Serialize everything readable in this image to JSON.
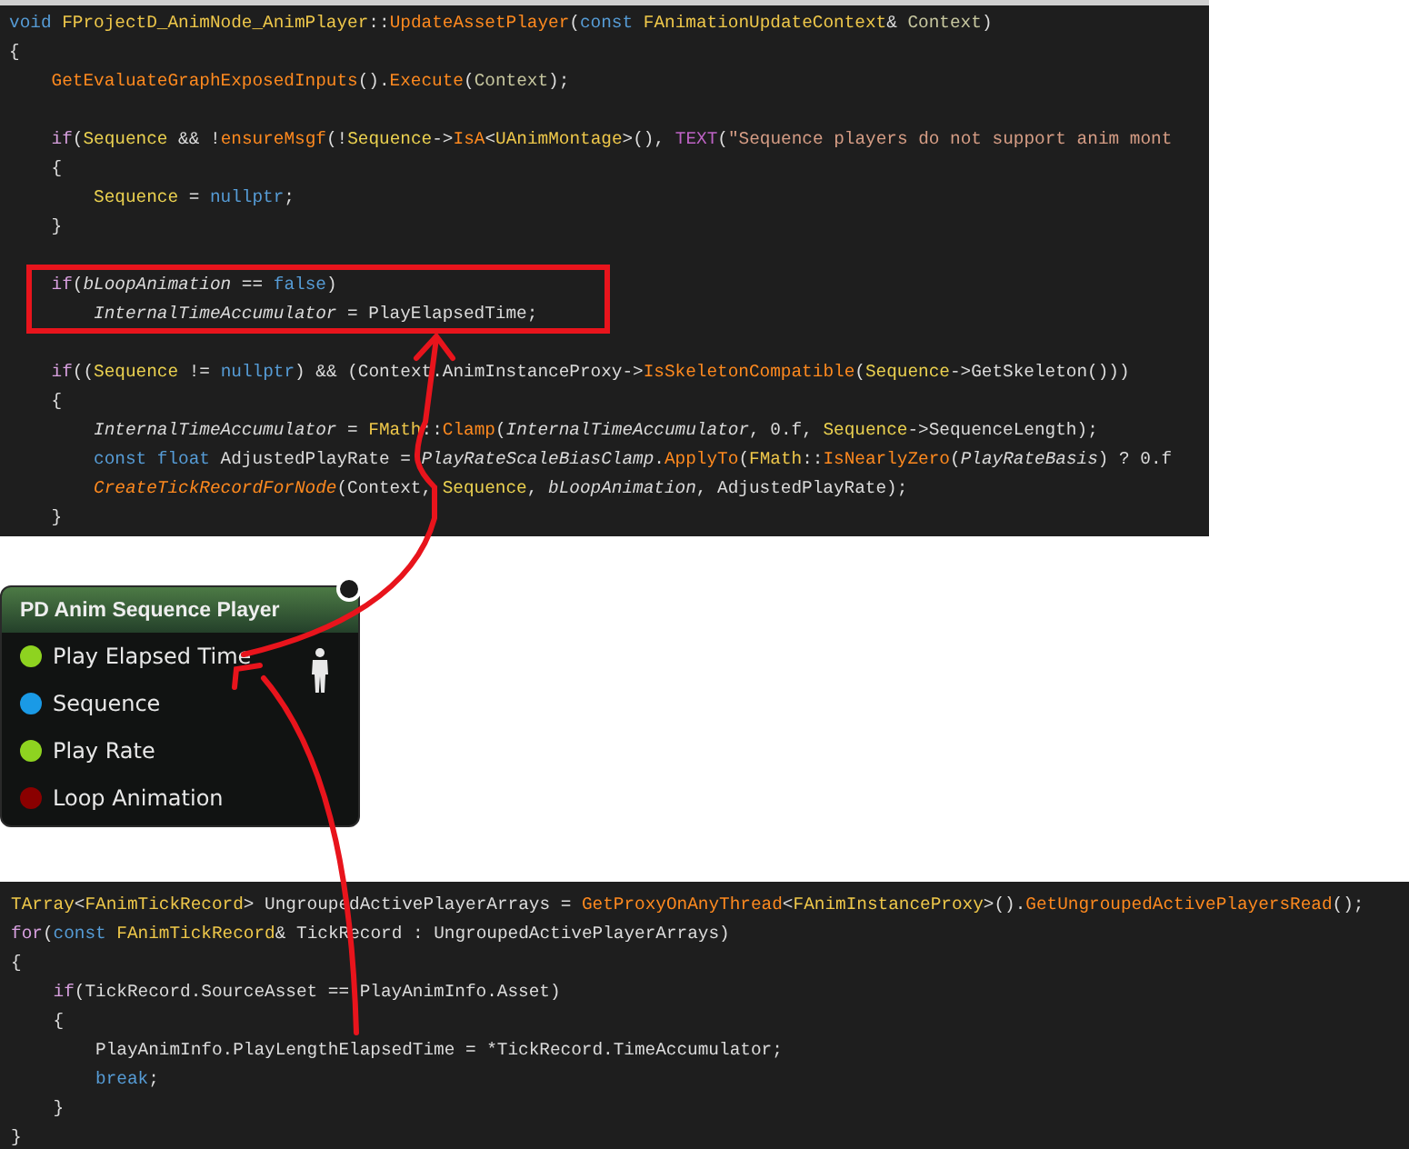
{
  "top_code": {
    "lines": [
      {
        "kind": "code",
        "tokens": [
          {
            "text": "void ",
            "kind": "kw"
          },
          {
            "text": "FProjectD_AnimNode_AnimPlayer",
            "kind": "type"
          },
          {
            "text": "::",
            "kind": "plain"
          },
          {
            "text": "UpdateAssetPlayer",
            "kind": "func"
          },
          {
            "text": "(",
            "kind": "plain"
          },
          {
            "text": "const ",
            "kind": "kw"
          },
          {
            "text": "FAnimationUpdateContext",
            "kind": "type"
          },
          {
            "text": "& ",
            "kind": "plain"
          },
          {
            "text": "Context",
            "kind": "param"
          },
          {
            "text": ")",
            "kind": "plain"
          }
        ]
      },
      {
        "kind": "code",
        "tokens": [
          {
            "text": "{",
            "kind": "plain"
          }
        ]
      },
      {
        "kind": "code",
        "tokens": [
          {
            "text": "    GetEvaluateGraphExposedInputs",
            "kind": "func"
          },
          {
            "text": "().",
            "kind": "plain"
          },
          {
            "text": "Execute",
            "kind": "func"
          },
          {
            "text": "(",
            "kind": "plain"
          },
          {
            "text": "Context",
            "kind": "param"
          },
          {
            "text": ");",
            "kind": "plain"
          }
        ]
      },
      {
        "kind": "blank"
      },
      {
        "kind": "code",
        "tokens": [
          {
            "text": "    if",
            "kind": "ctrl"
          },
          {
            "text": "(",
            "kind": "plain"
          },
          {
            "text": "Sequence",
            "kind": "field"
          },
          {
            "text": " && !",
            "kind": "plain"
          },
          {
            "text": "ensureMsgf",
            "kind": "func"
          },
          {
            "text": "(!",
            "kind": "plain"
          },
          {
            "text": "Sequence",
            "kind": "field"
          },
          {
            "text": "->",
            "kind": "plain"
          },
          {
            "text": "IsA",
            "kind": "func"
          },
          {
            "text": "<",
            "kind": "plain"
          },
          {
            "text": "UAnimMontage",
            "kind": "type"
          },
          {
            "text": ">(), ",
            "kind": "plain"
          },
          {
            "text": "TEXT",
            "kind": "macro"
          },
          {
            "text": "(",
            "kind": "plain"
          },
          {
            "text": "\"Sequence players do not support anim mont",
            "kind": "string"
          }
        ]
      },
      {
        "kind": "code",
        "tokens": [
          {
            "text": "    {",
            "kind": "plain"
          }
        ]
      },
      {
        "kind": "code",
        "tokens": [
          {
            "text": "        Sequence",
            "kind": "field"
          },
          {
            "text": " = ",
            "kind": "plain"
          },
          {
            "text": "nullptr",
            "kind": "kw"
          },
          {
            "text": ";",
            "kind": "plain"
          }
        ]
      },
      {
        "kind": "code",
        "tokens": [
          {
            "text": "    }",
            "kind": "plain"
          }
        ]
      },
      {
        "kind": "blank"
      },
      {
        "kind": "code",
        "tokens": [
          {
            "text": "    if",
            "kind": "ctrl"
          },
          {
            "text": "(",
            "kind": "plain"
          },
          {
            "text": "bLoopAnimation",
            "kind": "member"
          },
          {
            "text": " == ",
            "kind": "plain"
          },
          {
            "text": "false",
            "kind": "kw"
          },
          {
            "text": ")",
            "kind": "plain"
          }
        ]
      },
      {
        "kind": "code",
        "tokens": [
          {
            "text": "        InternalTimeAccumulator",
            "kind": "member"
          },
          {
            "text": " = PlayElapsedTime;",
            "kind": "plain"
          }
        ]
      },
      {
        "kind": "blank"
      },
      {
        "kind": "code",
        "tokens": [
          {
            "text": "    if",
            "kind": "ctrl"
          },
          {
            "text": "((",
            "kind": "plain"
          },
          {
            "text": "Sequence",
            "kind": "field"
          },
          {
            "text": " != ",
            "kind": "plain"
          },
          {
            "text": "nullptr",
            "kind": "kw"
          },
          {
            "text": ") && (Context.AnimInstanceProxy->",
            "kind": "plain"
          },
          {
            "text": "IsSkeletonCompatible",
            "kind": "func"
          },
          {
            "text": "(",
            "kind": "plain"
          },
          {
            "text": "Sequence",
            "kind": "field"
          },
          {
            "text": "->GetSkeleton()))",
            "kind": "plain"
          }
        ]
      },
      {
        "kind": "code",
        "tokens": [
          {
            "text": "    {",
            "kind": "plain"
          }
        ]
      },
      {
        "kind": "code",
        "tokens": [
          {
            "text": "        InternalTimeAccumulator",
            "kind": "member"
          },
          {
            "text": " = ",
            "kind": "plain"
          },
          {
            "text": "FMath",
            "kind": "type"
          },
          {
            "text": "::",
            "kind": "plain"
          },
          {
            "text": "Clamp",
            "kind": "func"
          },
          {
            "text": "(",
            "kind": "plain"
          },
          {
            "text": "InternalTimeAccumulator",
            "kind": "member"
          },
          {
            "text": ", 0.f, ",
            "kind": "plain"
          },
          {
            "text": "Sequence",
            "kind": "field"
          },
          {
            "text": "->SequenceLength);",
            "kind": "plain"
          }
        ]
      },
      {
        "kind": "code",
        "tokens": [
          {
            "text": "        const float",
            "kind": "kw"
          },
          {
            "text": " AdjustedPlayRate = ",
            "kind": "plain"
          },
          {
            "text": "PlayRateScaleBiasClamp",
            "kind": "member"
          },
          {
            "text": ".",
            "kind": "plain"
          },
          {
            "text": "ApplyTo",
            "kind": "func"
          },
          {
            "text": "(",
            "kind": "plain"
          },
          {
            "text": "FMath",
            "kind": "type"
          },
          {
            "text": "::",
            "kind": "plain"
          },
          {
            "text": "IsNearlyZero",
            "kind": "func"
          },
          {
            "text": "(",
            "kind": "plain"
          },
          {
            "text": "PlayRateBasis",
            "kind": "member"
          },
          {
            "text": ") ? 0.f",
            "kind": "plain"
          }
        ]
      },
      {
        "kind": "code",
        "tokens": [
          {
            "text": "        CreateTickRecordForNode",
            "kind": "funcitalic"
          },
          {
            "text": "(Context, ",
            "kind": "plain"
          },
          {
            "text": "Sequence",
            "kind": "field"
          },
          {
            "text": ", ",
            "kind": "plain"
          },
          {
            "text": "bLoopAnimation",
            "kind": "member"
          },
          {
            "text": ", AdjustedPlayRate);",
            "kind": "plain"
          }
        ]
      },
      {
        "kind": "code",
        "tokens": [
          {
            "text": "    }",
            "kind": "plain"
          }
        ]
      }
    ]
  },
  "node": {
    "title": "PD Anim Sequence Player",
    "pins": [
      {
        "label": "Play Elapsed Time",
        "color": "#8ed320"
      },
      {
        "label": "Sequence",
        "color": "#1a9ae6"
      },
      {
        "label": "Play Rate",
        "color": "#8ed320"
      },
      {
        "label": "Loop Animation",
        "color": "#8a0000"
      }
    ]
  },
  "bottom_code": {
    "lines": [
      {
        "kind": "code",
        "tokens": [
          {
            "text": "TArray",
            "kind": "type"
          },
          {
            "text": "<",
            "kind": "plain"
          },
          {
            "text": "FAnimTickRecord",
            "kind": "type"
          },
          {
            "text": "> UngroupedActivePlayerArrays = ",
            "kind": "plain"
          },
          {
            "text": "GetProxyOnAnyThread",
            "kind": "func"
          },
          {
            "text": "<",
            "kind": "plain"
          },
          {
            "text": "FAnimInstanceProxy",
            "kind": "type"
          },
          {
            "text": ">().",
            "kind": "plain"
          },
          {
            "text": "GetUngroupedActivePlayersRead",
            "kind": "func"
          },
          {
            "text": "();",
            "kind": "plain"
          }
        ]
      },
      {
        "kind": "code",
        "tokens": [
          {
            "text": "for",
            "kind": "ctrl"
          },
          {
            "text": "(",
            "kind": "plain"
          },
          {
            "text": "const ",
            "kind": "kw"
          },
          {
            "text": "FAnimTickRecord",
            "kind": "type"
          },
          {
            "text": "& TickRecord : UngroupedActivePlayerArrays)",
            "kind": "plain"
          }
        ]
      },
      {
        "kind": "code",
        "tokens": [
          {
            "text": "{",
            "kind": "plain"
          }
        ]
      },
      {
        "kind": "code",
        "tokens": [
          {
            "text": "    if",
            "kind": "ctrl"
          },
          {
            "text": "(TickRecord.SourceAsset == PlayAnimInfo.Asset)",
            "kind": "plain"
          }
        ]
      },
      {
        "kind": "code",
        "tokens": [
          {
            "text": "    {",
            "kind": "plain"
          }
        ]
      },
      {
        "kind": "code",
        "tokens": [
          {
            "text": "        PlayAnimInfo.PlayLengthElapsedTime = *TickRecord.TimeAccumulator;",
            "kind": "plain"
          }
        ]
      },
      {
        "kind": "code",
        "tokens": [
          {
            "text": "        break",
            "kind": "kw"
          },
          {
            "text": ";",
            "kind": "plain"
          }
        ]
      },
      {
        "kind": "code",
        "tokens": [
          {
            "text": "    }",
            "kind": "plain"
          }
        ]
      },
      {
        "kind": "code",
        "tokens": [
          {
            "text": "}",
            "kind": "plain"
          }
        ]
      }
    ]
  }
}
